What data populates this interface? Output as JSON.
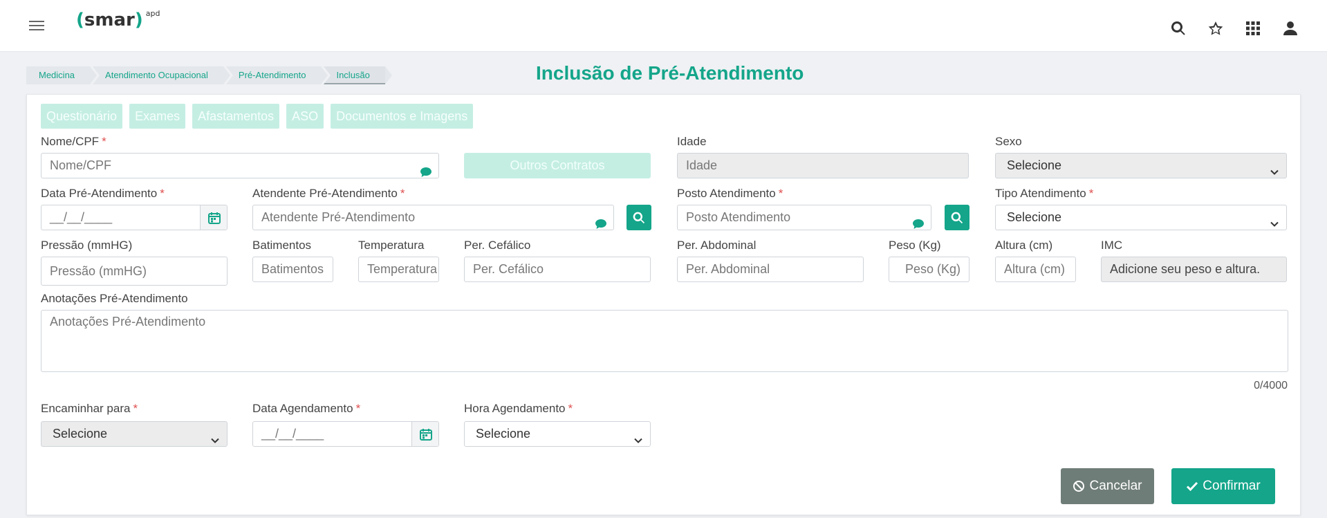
{
  "app": {
    "logo_text": "smar",
    "logo_suffix": "apd",
    "icons": [
      "menu-icon",
      "search-icon",
      "star-icon",
      "apps-grid-icon",
      "user-icon"
    ]
  },
  "breadcrumb": [
    {
      "label": "Medicina"
    },
    {
      "label": "Atendimento Ocupacional"
    },
    {
      "label": "Pré-Atendimento"
    },
    {
      "label": "Inclusão"
    }
  ],
  "page_title": "Inclusão de Pré-Atendimento",
  "tabs": [
    {
      "label": "Questionário"
    },
    {
      "label": "Exames"
    },
    {
      "label": "Afastamentos"
    },
    {
      "label": "ASO"
    },
    {
      "label": "Documentos e Imagens"
    }
  ],
  "form": {
    "nome_cpf": {
      "label": "Nome/CPF",
      "required": "*",
      "placeholder": "Nome/CPF"
    },
    "outros_contratos": {
      "label": "Outros Contratos"
    },
    "idade": {
      "label": "Idade",
      "placeholder": "Idade"
    },
    "sexo": {
      "label": "Sexo",
      "value": "Selecione"
    },
    "data_pre": {
      "label": "Data Pré-Atendimento",
      "required": "*",
      "placeholder": "__/__/____"
    },
    "atendente": {
      "label": "Atendente Pré-Atendimento",
      "required": "*",
      "placeholder": "Atendente Pré-Atendimento"
    },
    "posto": {
      "label": "Posto Atendimento",
      "required": "*",
      "placeholder": "Posto Atendimento"
    },
    "tipo": {
      "label": "Tipo Atendimento",
      "required": "*",
      "value": "Selecione"
    },
    "pressao": {
      "label": "Pressão (mmHG)",
      "placeholder": "Pressão (mmHG)"
    },
    "batimentos": {
      "label": "Batimentos",
      "placeholder": "Batimentos"
    },
    "temperatura": {
      "label": "Temperatura",
      "placeholder": "Temperatura"
    },
    "cefalico": {
      "label": "Per. Cefálico",
      "placeholder": "Per. Cefálico"
    },
    "abdominal": {
      "label": "Per. Abdominal",
      "placeholder": "Per. Abdominal"
    },
    "peso": {
      "label": "Peso (Kg)",
      "placeholder": "Peso (Kg)"
    },
    "altura": {
      "label": "Altura (cm)",
      "placeholder": "Altura (cm)"
    },
    "imc": {
      "label": "IMC",
      "placeholder": "Adicione seu peso e altura."
    },
    "anotacoes": {
      "label": "Anotações Pré-Atendimento",
      "placeholder": "Anotações Pré-Atendimento",
      "counter": "0/4000"
    },
    "encaminhar": {
      "label": "Encaminhar para",
      "required": "*",
      "value": "Selecione"
    },
    "data_agend": {
      "label": "Data Agendamento",
      "required": "*",
      "placeholder": "__/__/____"
    },
    "hora_agend": {
      "label": "Hora Agendamento",
      "required": "*",
      "value": "Selecione"
    }
  },
  "actions": {
    "cancel_label": "Cancelar",
    "confirm_label": "Confirmar"
  },
  "colors": {
    "accent": "#14a58a",
    "tab_bg": "#c5eee3",
    "cancel_bg": "#6f7d78"
  }
}
